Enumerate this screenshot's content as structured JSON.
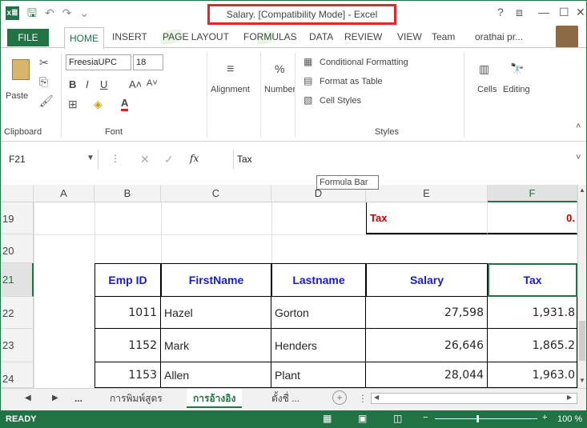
{
  "title": "Salary. [Compatibility Mode] - Excel",
  "window_controls": {
    "help": "?",
    "ribbon_display": "⧈",
    "minimize": "—",
    "restore": "☐",
    "close": "✕"
  },
  "qat": {
    "logo": "x≣",
    "save": "🖫",
    "undo": "↶",
    "redo": "↷",
    "more": "⌄"
  },
  "tabs": {
    "file": "FILE",
    "home": "HOME",
    "items": [
      "INSERT",
      "PAGE LAYOUT",
      "FORMULAS",
      "DATA",
      "REVIEW",
      "VIEW",
      "Team"
    ],
    "user": "orathai pr..."
  },
  "ribbon": {
    "clipboard": {
      "paste": "Paste",
      "label": "Clipboard"
    },
    "font": {
      "name": "FreesiaUPC",
      "size": "18",
      "bold": "B",
      "italic": "I",
      "underline": "U",
      "grow": "A˄",
      "shrink": "A˅",
      "font_color": "A",
      "label": "Font"
    },
    "alignment": {
      "label": "Alignment"
    },
    "number": {
      "symbol": "%",
      "label": "Number"
    },
    "styles": {
      "conditional": "Conditional Formatting",
      "format_table": "Format as Table",
      "cell_styles": "Cell Styles",
      "label": "Styles"
    },
    "cells": {
      "label": "Cells"
    },
    "editing": {
      "label": "Editing"
    }
  },
  "formula_bar": {
    "name_box": "F21",
    "cancel": "✕",
    "enter": "✓",
    "fx": "fx",
    "value": "Tax",
    "tooltip": "Formula Bar"
  },
  "columns": [
    "A",
    "B",
    "C",
    "D",
    "E",
    "F"
  ],
  "rows": [
    "19",
    "20",
    "21",
    "22",
    "23",
    "24"
  ],
  "cells": {
    "tax_label": "Tax",
    "tax_rate": "0.",
    "headers": [
      "Emp ID",
      "FirstName",
      "Lastname",
      "Salary",
      "Tax"
    ],
    "data": [
      [
        "1011",
        "Hazel",
        "Gorton",
        "27,598",
        "1,931.8"
      ],
      [
        "1152",
        "Mark",
        "Henders",
        "26,646",
        "1,865.2"
      ],
      [
        "1153",
        "Allen",
        "Plant",
        "28,044",
        "1,963.0"
      ]
    ]
  },
  "sheet_tabs": {
    "ellipsis": "...",
    "tabs": [
      "การพิมพ์สูตร",
      "การอ้างอิง",
      "ตั้งชื่ ..."
    ],
    "active_index": 1,
    "add": "+"
  },
  "status": {
    "mode": "READY",
    "zoom": "100 %"
  },
  "colors": {
    "accent": "#217346",
    "header_text": "#1b1bc8",
    "tax_text": "#c00000",
    "highlight": "#e8262a"
  }
}
